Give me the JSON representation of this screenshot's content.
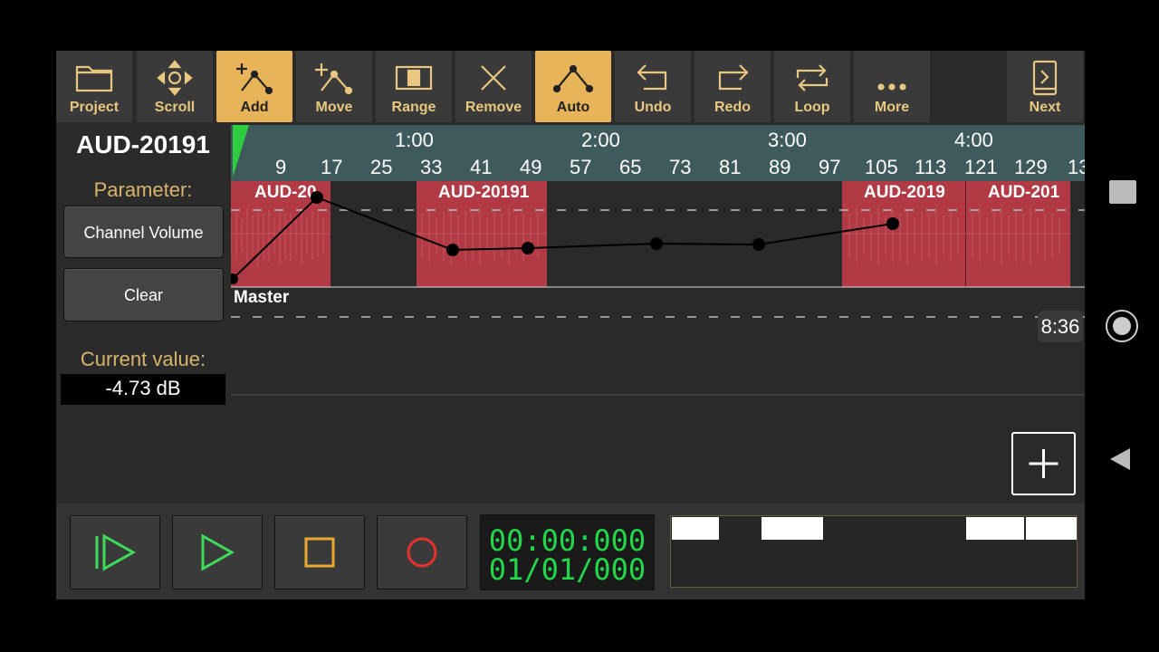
{
  "toolbar": {
    "items": [
      {
        "label": "Project",
        "icon": "folder-icon",
        "active": false
      },
      {
        "label": "Scroll",
        "icon": "scroll-arrows-icon",
        "active": false
      },
      {
        "label": "Add",
        "icon": "add-point-icon",
        "active": true
      },
      {
        "label": "Move",
        "icon": "move-point-icon",
        "active": false
      },
      {
        "label": "Range",
        "icon": "range-icon",
        "active": false
      },
      {
        "label": "Remove",
        "icon": "remove-x-icon",
        "active": false
      },
      {
        "label": "Auto",
        "icon": "automation-icon",
        "active": true
      },
      {
        "label": "Undo",
        "icon": "undo-icon",
        "active": false
      },
      {
        "label": "Redo",
        "icon": "redo-icon",
        "active": false
      },
      {
        "label": "Loop",
        "icon": "loop-icon",
        "active": false
      },
      {
        "label": "More",
        "icon": "more-dots-icon",
        "active": false
      }
    ],
    "next_label": "Next"
  },
  "track": {
    "name": "AUD-20191",
    "parameter_label": "Parameter:",
    "parameter_button": "Channel Volume",
    "clear_button": "Clear",
    "current_value_label": "Current value:",
    "current_value": "-4.73 dB"
  },
  "ruler": {
    "time_labels": [
      "1:00",
      "2:00",
      "3:00",
      "4:00"
    ],
    "bar_labels": [
      "9",
      "17",
      "25",
      "33",
      "41",
      "49",
      "57",
      "65",
      "73",
      "81",
      "89",
      "97",
      "105",
      "113",
      "121",
      "129",
      "13"
    ]
  },
  "clips": [
    {
      "title": "AUD-20"
    },
    {
      "title": "AUD-20191"
    },
    {
      "title": "AUD-2019"
    },
    {
      "title": "AUD-201"
    }
  ],
  "master_label": "Master",
  "time_badge": "8:36",
  "transport": {
    "counter_time": "00:00:000",
    "counter_bars": "01/01/000"
  },
  "colors": {
    "accent": "#e8b45a",
    "clip": "#b13a45",
    "counter": "#22d84a",
    "ruler": "#3f5a5c"
  }
}
